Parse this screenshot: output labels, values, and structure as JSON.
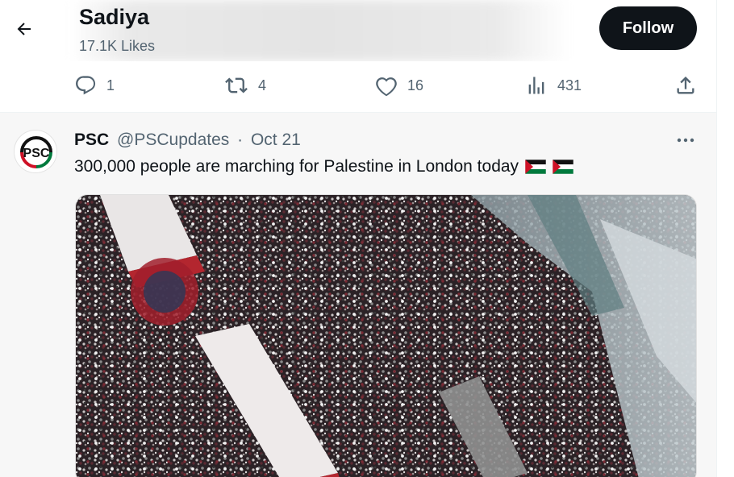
{
  "header": {
    "title": "Sadiya",
    "subtitle": "17.1K Likes",
    "follow_label": "Follow"
  },
  "actions": {
    "reply_count": "1",
    "repost_count": "4",
    "like_count": "16",
    "views_count": "431"
  },
  "tweet": {
    "name": "PSC",
    "handle": "@PSCupdates",
    "separator": "·",
    "date": "Oct 21",
    "text": "300,000 people are marching for Palestine in London today",
    "avatar_text": "PSC",
    "flags": [
      "palestine-flag",
      "palestine-flag"
    ]
  },
  "icons": {
    "back": "arrow-left-icon",
    "reply": "reply-icon",
    "repost": "repost-icon",
    "like": "heart-icon",
    "views": "analytics-icon",
    "share": "share-icon",
    "more": "more-horizontal-icon"
  },
  "colors": {
    "text_primary": "#0f1419",
    "text_secondary": "#536471",
    "follow_bg": "#0f1419",
    "palestine_red": "#ce1126",
    "palestine_green": "#007a3d"
  }
}
